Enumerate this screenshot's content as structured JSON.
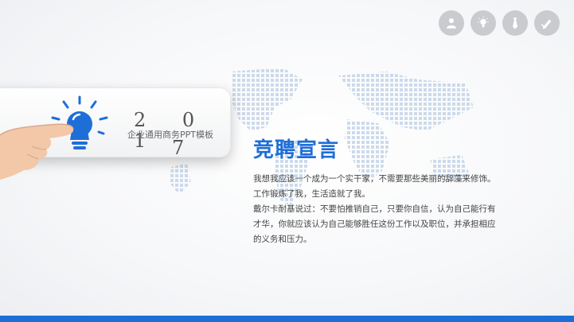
{
  "top_icons": [
    "person-icon",
    "lightbulb-icon",
    "tie-icon",
    "pen-hand-icon"
  ],
  "card": {
    "year": "2 0 1",
    "year_last": "7",
    "subtitle": "企业通用商务PPT模板"
  },
  "title": "竞聘宣言",
  "body": [
    "我想我应该一个成为一个实干家，不需要那些美丽的辞藻来修饰。",
    "工作锻炼了我，生活造就了我。",
    "戴尔卡耐基说过：不要怕推销自己，只要你自信，认为自己能行有",
    "才华，你就应该认为自己能够胜任这份工作以及职位，并承担相应",
    "的义务和压力。"
  ],
  "colors": {
    "accent": "#1e6ed8",
    "icon_bg": "#c9cbcf"
  }
}
